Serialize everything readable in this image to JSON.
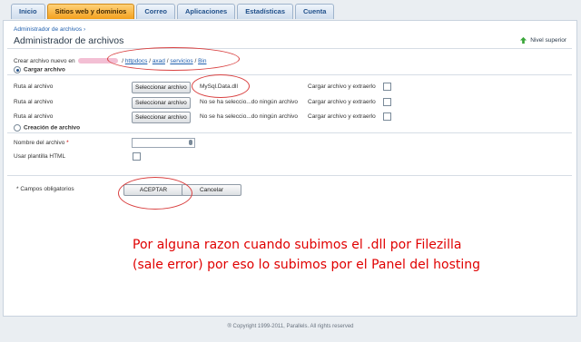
{
  "tabs": [
    "Inicio",
    "Sitios web y dominios",
    "Correo",
    "Aplicaciones",
    "Estadísticas",
    "Cuenta"
  ],
  "active_tab_index": 1,
  "breadcrumb": "Administrador de archivos ›",
  "page_title": "Administrador de archivos",
  "up_level_label": "Nivel superior",
  "path": {
    "prefix": "Crear archivo nuevo en",
    "sep1": " / ",
    "seg1": "httpdocs",
    "sep2": " / ",
    "seg2": "axad",
    "sep3": " / ",
    "seg3": "servicios",
    "sep4": " / ",
    "seg4": "Bin"
  },
  "upload_section": {
    "title": "Cargar archivo",
    "rows": [
      {
        "label": "Ruta al archivo",
        "button": "Seleccionar archivo",
        "file_text": "MySql.Data.dll",
        "extract_label": "Cargar archivo y extraerlo"
      },
      {
        "label": "Ruta al archivo",
        "button": "Seleccionar archivo",
        "file_text": "No se ha seleccio...do ningún archivo",
        "extract_label": "Cargar archivo y extraerlo"
      },
      {
        "label": "Ruta al archivo",
        "button": "Seleccionar archivo",
        "file_text": "No se ha seleccio...do ningún archivo",
        "extract_label": "Cargar archivo y extraerlo"
      }
    ]
  },
  "create_section": {
    "title": "Creación de archivo",
    "name_label": "Nombre del archivo",
    "required_star": "*",
    "html_template_label": "Usar plantilla HTML"
  },
  "required_note": "* Campos obligatorios",
  "buttons": {
    "accept": "ACEPTAR",
    "cancel": "Cancelar"
  },
  "annotation": {
    "line1": "Por alguna razon cuando subimos el .dll  por Filezilla",
    "line2": "(sale error) por eso lo subimos por el Panel del hosting"
  },
  "footer": "® Copyright 1999-2011, Parallels. All rights reserved",
  "colors": {
    "active_tab": "#f3a01e",
    "annotation": "#e00000",
    "link": "#1f5fae"
  }
}
